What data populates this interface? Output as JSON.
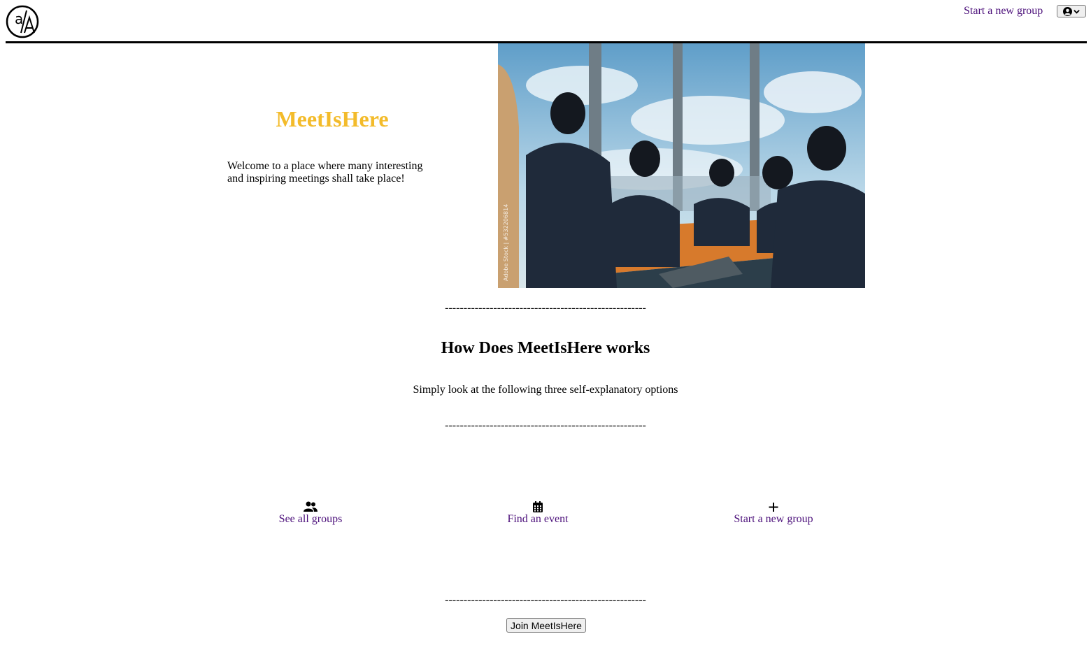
{
  "header": {
    "logo_text": "a/A",
    "nav_link": "Start a new group",
    "profile_icon": "user-circle-icon",
    "dropdown_icon": "chevron-down-icon"
  },
  "hero": {
    "title": "MeetIsHere",
    "text": "Welcome to a place where many interesting and inspiring meetings shall take place!",
    "image_description_icon": "meeting-illustration",
    "watermark": "Adobe Stock | #532206814"
  },
  "divider_text": "------------------------------------------------------",
  "how": {
    "title": "How Does MeetIsHere works",
    "subtitle": "Simply look at the following three self-explanatory options"
  },
  "options": [
    {
      "label": "See all groups",
      "icon": "users-icon"
    },
    {
      "label": "Find an event",
      "icon": "calendar-icon"
    },
    {
      "label": "Start a new group",
      "icon": "plus-icon"
    }
  ],
  "join_button": "Join MeetIsHere",
  "colors": {
    "brand_title": "#f3bb2a",
    "link": "#4b0f7a"
  }
}
